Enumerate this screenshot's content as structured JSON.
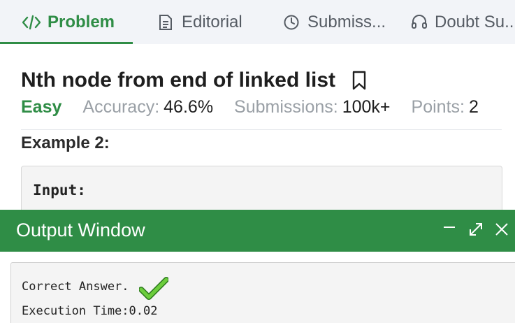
{
  "tabs": [
    {
      "label": "Problem",
      "icon": "code-icon",
      "active": true
    },
    {
      "label": "Editorial",
      "icon": "document-icon",
      "active": false
    },
    {
      "label": "Submiss...",
      "icon": "clock-icon",
      "active": false
    },
    {
      "label": "Doubt Su...",
      "icon": "headset-icon",
      "active": false
    }
  ],
  "problem": {
    "title": "Nth node from end of linked list",
    "difficulty": "Easy",
    "accuracy_label": "Accuracy:",
    "accuracy_value": "46.6%",
    "submissions_label": "Submissions:",
    "submissions_value": "100k+",
    "points_label": "Points:",
    "points_value": "2"
  },
  "example": {
    "title": "Example 2:",
    "input_label": "Input:"
  },
  "output": {
    "title": "Output Window",
    "result": "Correct Answer.",
    "time": "Execution Time:0.02"
  },
  "colors": {
    "brand_green": "#2f8d46",
    "tab_bg": "#f2f4f8",
    "muted": "#9aa0a6"
  }
}
